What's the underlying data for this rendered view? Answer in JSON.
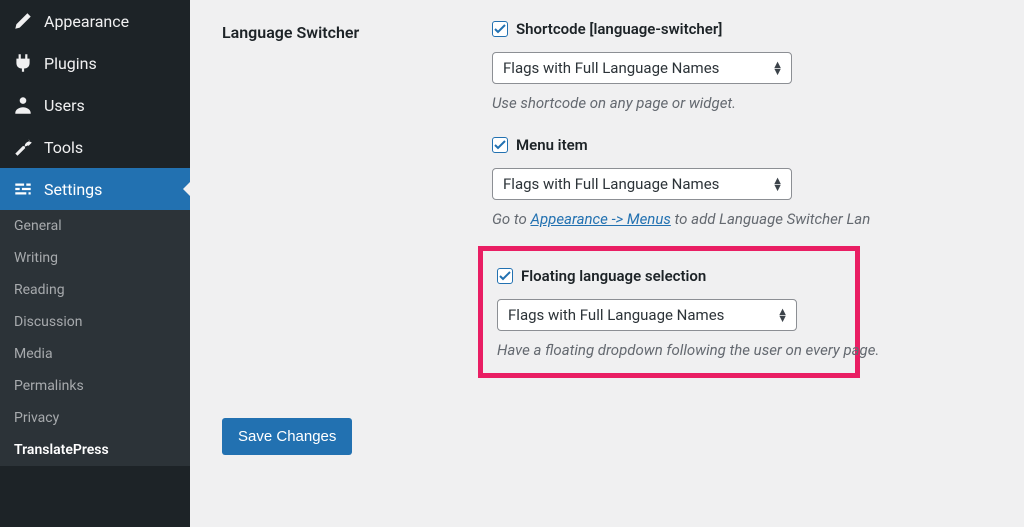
{
  "sidebar": {
    "main": [
      {
        "name": "appearance",
        "label": "Appearance"
      },
      {
        "name": "plugins",
        "label": "Plugins"
      },
      {
        "name": "users",
        "label": "Users"
      },
      {
        "name": "tools",
        "label": "Tools"
      },
      {
        "name": "settings",
        "label": "Settings"
      }
    ],
    "sub": [
      {
        "label": "General"
      },
      {
        "label": "Writing"
      },
      {
        "label": "Reading"
      },
      {
        "label": "Discussion"
      },
      {
        "label": "Media"
      },
      {
        "label": "Permalinks"
      },
      {
        "label": "Privacy"
      },
      {
        "label": "TranslatePress"
      }
    ]
  },
  "form": {
    "section_label": "Language Switcher",
    "shortcode": {
      "label": "Shortcode [language-switcher]",
      "select_value": "Flags with Full Language Names",
      "description": "Use shortcode on any page or widget."
    },
    "menu_item": {
      "label": "Menu item",
      "select_value": "Flags with Full Language Names",
      "description_prefix": "Go to ",
      "link_text": "Appearance -> Menus",
      "description_suffix": " to add Language Switcher Lan"
    },
    "floating": {
      "label": "Floating language selection",
      "select_value": "Flags with Full Language Names",
      "description": "Have a floating dropdown following the user on every page."
    },
    "save_button": "Save Changes"
  }
}
